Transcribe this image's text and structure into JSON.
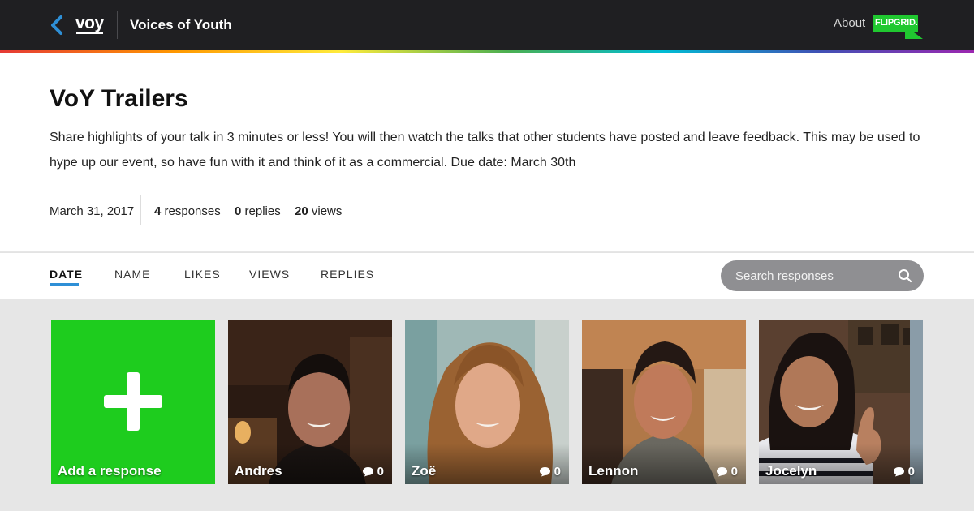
{
  "topbar": {
    "brand": "voy",
    "group_title": "Voices of Youth",
    "about": "About",
    "flipgrid_logo": "FLIPGRID."
  },
  "topic": {
    "title": "VoY Trailers",
    "description": "Share highlights of your talk in 3 minutes or less! You will then watch the talks that other students have posted and leave feedback. This may be used to hype up our event, so have fun with it and think of it as a commercial. Due date: March 30th",
    "date": "March 31, 2017",
    "responses_count": "4",
    "responses_label": "responses",
    "replies_count": "0",
    "replies_label": "replies",
    "views_count": "20",
    "views_label": "views"
  },
  "sort_tabs": [
    "DATE",
    "NAME",
    "LIKES",
    "VIEWS",
    "REPLIES"
  ],
  "active_tab": "DATE",
  "search": {
    "placeholder": "Search responses"
  },
  "add_card": {
    "label": "Add a response"
  },
  "responses": [
    {
      "name": "Andres",
      "replies": "0"
    },
    {
      "name": "Zoë",
      "replies": "0"
    },
    {
      "name": "Lennon",
      "replies": "0"
    },
    {
      "name": "Jocelyn",
      "replies": "0"
    }
  ],
  "colors": {
    "topbar": "#1f1f22",
    "accent_blue": "#2e8fd6",
    "add_green": "#1ecc1e",
    "flipgrid_green": "#20c830"
  }
}
